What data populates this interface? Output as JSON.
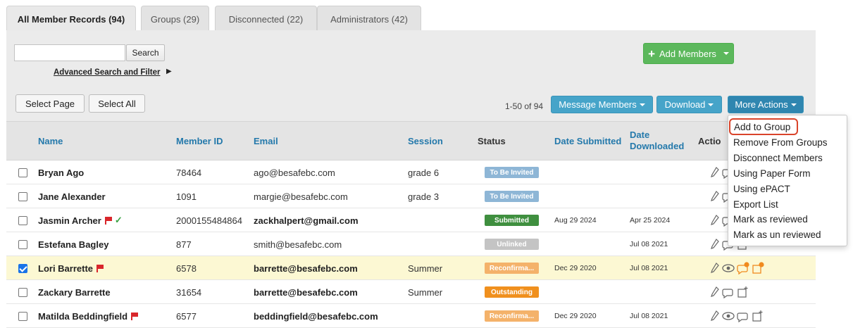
{
  "tabs": [
    {
      "label": "All Member Records (94)",
      "active": true
    },
    {
      "label": "Groups (29)",
      "active": false
    },
    {
      "label": "Disconnected (22)",
      "active": false
    },
    {
      "label": "Administrators (42)",
      "active": false
    }
  ],
  "search": {
    "value": "",
    "button_label": "Search",
    "advanced_label": "Advanced Search and Filter",
    "advanced_arrow": "▶"
  },
  "selection": {
    "select_page": "Select Page",
    "select_all": "Select All"
  },
  "add_members": {
    "label": "Add Members"
  },
  "pagination": {
    "range_text": "1-50 of 94"
  },
  "toolbar": {
    "message_members": "Message Members",
    "download": "Download",
    "more_actions": "More Actions"
  },
  "table": {
    "headers": {
      "name": "Name",
      "member_id": "Member ID",
      "email": "Email",
      "session": "Session",
      "status": "Status",
      "date_submitted": "Date Submitted",
      "date_downloaded_1": "Date",
      "date_downloaded_2": "Downloaded",
      "actions": "Actio"
    },
    "rows": [
      {
        "name": "Bryan Ago",
        "member_id": "78464",
        "email": "ago@besafebc.com",
        "email_bold": false,
        "session": "grade 6",
        "status": "To Be Invited",
        "status_color": "#8eb6d6",
        "date_submitted": "",
        "date_downloaded": "",
        "checked": false,
        "flag": false,
        "verified": false,
        "highlighted": false
      },
      {
        "name": "Jane Alexander",
        "member_id": "1091",
        "email": "margie@besafebc.com",
        "email_bold": false,
        "session": "grade 3",
        "status": "To Be Invited",
        "status_color": "#8eb6d6",
        "date_submitted": "",
        "date_downloaded": "",
        "checked": false,
        "flag": false,
        "verified": false,
        "highlighted": false
      },
      {
        "name": "Jasmin Archer",
        "member_id": "2000155484864",
        "email": "zackhalpert@gmail.com",
        "email_bold": true,
        "session": "",
        "status": "Submitted",
        "status_color": "#3f8f3f",
        "date_submitted": "Aug 29 2024",
        "date_downloaded": "Apr 25 2024",
        "checked": false,
        "flag": true,
        "verified": true,
        "highlighted": false
      },
      {
        "name": "Estefana Bagley",
        "member_id": "877",
        "email": "smith@besafebc.com",
        "email_bold": false,
        "session": "",
        "status": "Unlinked",
        "status_color": "#c4c4c4",
        "date_submitted": "",
        "date_downloaded": "Jul 08 2021",
        "checked": false,
        "flag": false,
        "verified": false,
        "highlighted": false
      },
      {
        "name": "Lori Barrette",
        "member_id": "6578",
        "email": "barrette@besafebc.com",
        "email_bold": true,
        "session": "Summer",
        "status": "Reconfirma...",
        "status_color": "#f4b26a",
        "date_submitted": "Dec 29 2020",
        "date_downloaded": "Jul 08 2021",
        "checked": true,
        "flag": true,
        "verified": false,
        "highlighted": true
      },
      {
        "name": "Zackary Barrette",
        "member_id": "31654",
        "email": "barrette@besafebc.com",
        "email_bold": true,
        "session": "Summer",
        "status": "Outstanding",
        "status_color": "#f0901e",
        "date_submitted": "",
        "date_downloaded": "",
        "checked": false,
        "flag": false,
        "verified": false,
        "highlighted": false
      },
      {
        "name": "Matilda Beddingfield",
        "member_id": "6577",
        "email": "beddingfield@besafebc.com",
        "email_bold": true,
        "session": "",
        "status": "Reconfirma...",
        "status_color": "#f4b26a",
        "date_submitted": "Dec 29 2020",
        "date_downloaded": "Jul 08 2021",
        "checked": false,
        "flag": true,
        "verified": false,
        "highlighted": false
      }
    ]
  },
  "more_actions_menu": [
    {
      "label": "Add to Group",
      "highlighted": true
    },
    {
      "label": "Remove From Groups",
      "highlighted": false
    },
    {
      "label": "Disconnect Members",
      "highlighted": false
    },
    {
      "label": "Using Paper Form",
      "highlighted": false
    },
    {
      "label": "Using ePACT",
      "highlighted": false
    },
    {
      "label": "Export List",
      "highlighted": false
    },
    {
      "label": "Mark as reviewed",
      "highlighted": false
    },
    {
      "label": "Mark as un reviewed",
      "highlighted": false
    }
  ],
  "colors": {
    "accent_blue": "#46a4c9",
    "green": "#5cb85c",
    "header_text": "#2479ab",
    "annotation_red": "#d9442b"
  }
}
